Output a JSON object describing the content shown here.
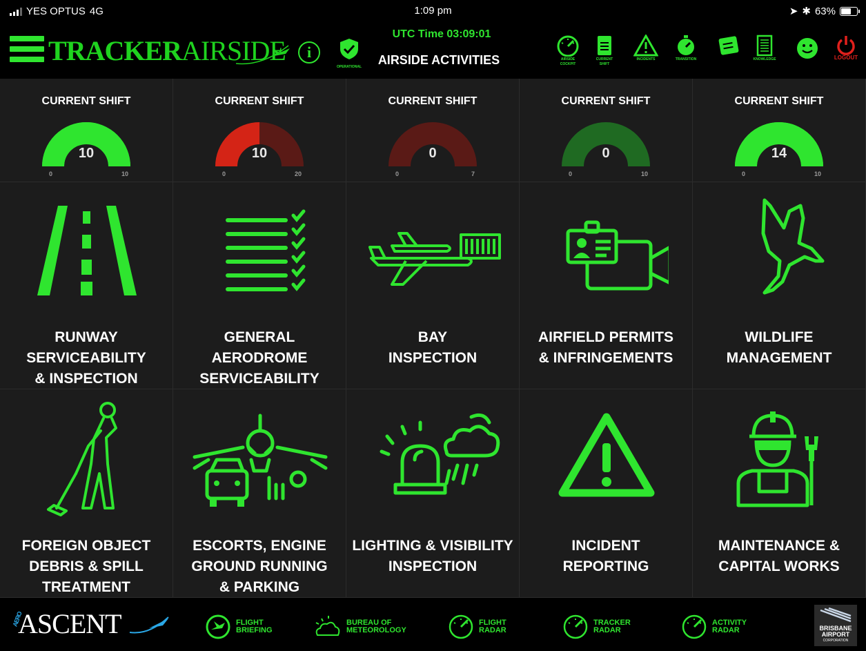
{
  "status_bar": {
    "carrier": "YES OPTUS",
    "network": "4G",
    "time": "1:09 pm",
    "battery": "63%",
    "battery_level": 0.63
  },
  "header": {
    "brand_part1": "TRACKER",
    "brand_part2": "AIRSIDE",
    "utc_time": "UTC Time 03:09:01",
    "page_title": "AIRSIDE ACTIVITIES",
    "operational_label": "OPERATIONAL",
    "icons": [
      {
        "name": "airside-cockpit",
        "label1": "AIRSIDE",
        "label2": "COCKPIT"
      },
      {
        "name": "current-shift",
        "label1": "CURRENT",
        "label2": "SHIFT"
      },
      {
        "name": "incidents",
        "label1": "INCIDENTS",
        "label2": ""
      },
      {
        "name": "transition",
        "label1": "TRANSITION",
        "label2": ""
      },
      {
        "name": "log-book",
        "label1": "",
        "label2": ""
      },
      {
        "name": "knowledge",
        "label1": "KNOWLEDGE",
        "label2": ""
      }
    ],
    "logout_label": "LOGOUT"
  },
  "shifts": [
    {
      "title": "CURRENT SHIFT",
      "value": "10",
      "min": "0",
      "max": "10",
      "fraction": 1.0,
      "fill_color": "#2fe52f",
      "track_color": "#2fe52f"
    },
    {
      "title": "CURRENT SHIFT",
      "value": "10",
      "min": "0",
      "max": "20",
      "fraction": 0.5,
      "fill_color": "#d42416",
      "track_color": "#5a1a16"
    },
    {
      "title": "CURRENT SHIFT",
      "value": "0",
      "min": "0",
      "max": "7",
      "fraction": 0.0,
      "fill_color": "#5a1a16",
      "track_color": "#5a1a16"
    },
    {
      "title": "CURRENT SHIFT",
      "value": "0",
      "min": "0",
      "max": "10",
      "fraction": 0.0,
      "fill_color": "#1f6a22",
      "track_color": "#1f6a22"
    },
    {
      "title": "CURRENT SHIFT",
      "value": "14",
      "min": "0",
      "max": "10",
      "fraction": 1.0,
      "fill_color": "#2fe52f",
      "track_color": "#2fe52f"
    }
  ],
  "tiles": [
    {
      "icon": "runway-icon",
      "lines": [
        "RUNWAY",
        "SERVICEABILITY",
        "& INSPECTION"
      ]
    },
    {
      "icon": "checklist-icon",
      "lines": [
        "GENERAL",
        "AERODROME",
        "SERVICEABILITY"
      ]
    },
    {
      "icon": "bay-aircraft-icon",
      "lines": [
        "BAY",
        "INSPECTION"
      ]
    },
    {
      "icon": "permit-camera-icon",
      "lines": [
        "AIRFIELD PERMITS",
        "& INFRINGEMENTS"
      ]
    },
    {
      "icon": "bird-icon",
      "lines": [
        "WILDLIFE",
        "MANAGEMENT"
      ]
    },
    {
      "icon": "sweeper-person-icon",
      "lines": [
        "FOREIGN OBJECT",
        "DEBRIS & SPILL",
        "TREATMENT"
      ]
    },
    {
      "icon": "plane-car-icon",
      "lines": [
        "ESCORTS, ENGINE",
        "GROUND RUNNING",
        "& PARKING"
      ]
    },
    {
      "icon": "beacon-weather-icon",
      "lines": [
        "LIGHTING & VISIBILITY",
        "INSPECTION"
      ]
    },
    {
      "icon": "warning-triangle-icon",
      "lines": [
        "INCIDENT",
        "REPORTING"
      ]
    },
    {
      "icon": "worker-wrench-icon",
      "lines": [
        "MAINTENANCE &",
        "CAPITAL WORKS"
      ]
    }
  ],
  "footer": {
    "logo_aero": "AERO",
    "logo_text": "ASCENT",
    "buttons": [
      {
        "icon": "flight-briefing-icon",
        "line1": "FLIGHT",
        "line2": "BRIEFING"
      },
      {
        "icon": "weather-icon",
        "line1": "BUREAU OF",
        "line2": "METEOROLOGY"
      },
      {
        "icon": "radar-gauge-icon",
        "line1": "FLIGHT",
        "line2": "RADAR"
      },
      {
        "icon": "radar-gauge-icon",
        "line1": "TRACKER",
        "line2": "RADAR"
      },
      {
        "icon": "radar-gauge-icon",
        "line1": "ACTIVITY",
        "line2": "RADAR"
      }
    ],
    "bac_line1": "BRISBANE",
    "bac_line2": "AIRPORT",
    "bac_line3": "CORPORATION"
  },
  "colors": {
    "accent": "#2fe52f",
    "alert": "#e0201c",
    "background": "#1c1c1c"
  }
}
